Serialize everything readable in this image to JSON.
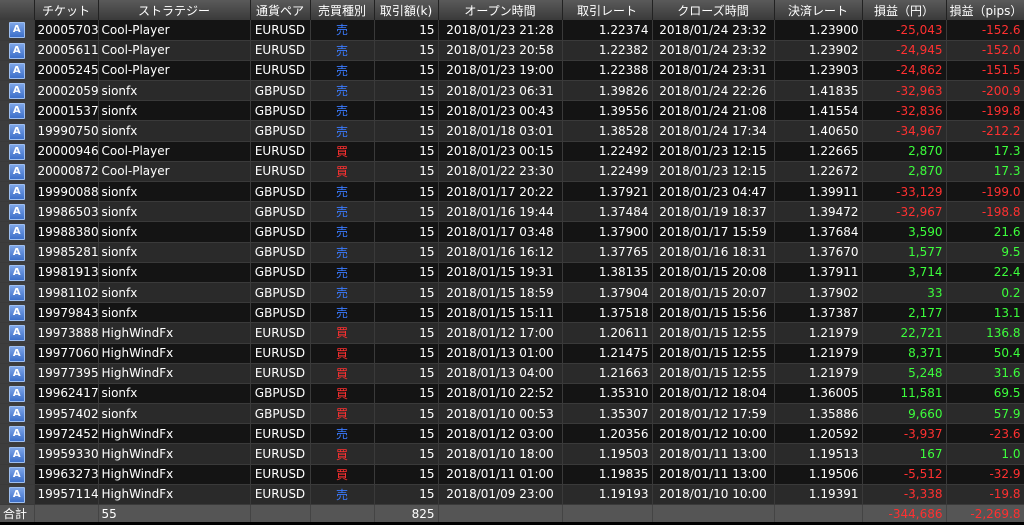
{
  "headers": {
    "icon": "",
    "ticket": "チケット",
    "strategy": "ストラテジー",
    "pair": "通貨ペア",
    "side": "売買種別",
    "amount": "取引額(k)",
    "open_time": "オープン時間",
    "open_rate": "取引レート",
    "close_time": "クローズ時間",
    "close_rate": "決済レート",
    "pl_yen": "損益（円）",
    "pl_pips": "損益（pips）"
  },
  "colors": {
    "sell": "#3a7bff",
    "buy": "#ff3030",
    "profit": "#3cff3c",
    "loss": "#ff3030"
  },
  "row_icon": "A",
  "rows": [
    {
      "ticket": "20005703",
      "strategy": "Cool-Player",
      "pair": "EURUSD",
      "side": "売",
      "amount": "15",
      "open_time": "2018/01/23 21:28",
      "open_rate": "1.22374",
      "close_time": "2018/01/24 23:32",
      "close_rate": "1.23900",
      "pl": "-25,043",
      "pips": "-152.6"
    },
    {
      "ticket": "20005611",
      "strategy": "Cool-Player",
      "pair": "EURUSD",
      "side": "売",
      "amount": "15",
      "open_time": "2018/01/23 20:58",
      "open_rate": "1.22382",
      "close_time": "2018/01/24 23:32",
      "close_rate": "1.23902",
      "pl": "-24,945",
      "pips": "-152.0"
    },
    {
      "ticket": "20005245",
      "strategy": "Cool-Player",
      "pair": "EURUSD",
      "side": "売",
      "amount": "15",
      "open_time": "2018/01/23 19:00",
      "open_rate": "1.22388",
      "close_time": "2018/01/24 23:31",
      "close_rate": "1.23903",
      "pl": "-24,862",
      "pips": "-151.5"
    },
    {
      "ticket": "20002059",
      "strategy": "sionfx",
      "pair": "GBPUSD",
      "side": "売",
      "amount": "15",
      "open_time": "2018/01/23 06:31",
      "open_rate": "1.39826",
      "close_time": "2018/01/24 22:26",
      "close_rate": "1.41835",
      "pl": "-32,963",
      "pips": "-200.9"
    },
    {
      "ticket": "20001537",
      "strategy": "sionfx",
      "pair": "GBPUSD",
      "side": "売",
      "amount": "15",
      "open_time": "2018/01/23 00:43",
      "open_rate": "1.39556",
      "close_time": "2018/01/24 21:08",
      "close_rate": "1.41554",
      "pl": "-32,836",
      "pips": "-199.8"
    },
    {
      "ticket": "19990750",
      "strategy": "sionfx",
      "pair": "GBPUSD",
      "side": "売",
      "amount": "15",
      "open_time": "2018/01/18 03:01",
      "open_rate": "1.38528",
      "close_time": "2018/01/24 17:34",
      "close_rate": "1.40650",
      "pl": "-34,967",
      "pips": "-212.2"
    },
    {
      "ticket": "20000946",
      "strategy": "Cool-Player",
      "pair": "EURUSD",
      "side": "買",
      "amount": "15",
      "open_time": "2018/01/23 00:15",
      "open_rate": "1.22492",
      "close_time": "2018/01/23 12:15",
      "close_rate": "1.22665",
      "pl": "2,870",
      "pips": "17.3"
    },
    {
      "ticket": "20000872",
      "strategy": "Cool-Player",
      "pair": "EURUSD",
      "side": "買",
      "amount": "15",
      "open_time": "2018/01/22 23:30",
      "open_rate": "1.22499",
      "close_time": "2018/01/23 12:15",
      "close_rate": "1.22672",
      "pl": "2,870",
      "pips": "17.3"
    },
    {
      "ticket": "19990088",
      "strategy": "sionfx",
      "pair": "GBPUSD",
      "side": "売",
      "amount": "15",
      "open_time": "2018/01/17 20:22",
      "open_rate": "1.37921",
      "close_time": "2018/01/23 04:47",
      "close_rate": "1.39911",
      "pl": "-33,129",
      "pips": "-199.0"
    },
    {
      "ticket": "19986503",
      "strategy": "sionfx",
      "pair": "GBPUSD",
      "side": "売",
      "amount": "15",
      "open_time": "2018/01/16 19:44",
      "open_rate": "1.37484",
      "close_time": "2018/01/19 18:37",
      "close_rate": "1.39472",
      "pl": "-32,967",
      "pips": "-198.8"
    },
    {
      "ticket": "19988380",
      "strategy": "sionfx",
      "pair": "GBPUSD",
      "side": "売",
      "amount": "15",
      "open_time": "2018/01/17 03:48",
      "open_rate": "1.37900",
      "close_time": "2018/01/17 15:59",
      "close_rate": "1.37684",
      "pl": "3,590",
      "pips": "21.6"
    },
    {
      "ticket": "19985281",
      "strategy": "sionfx",
      "pair": "GBPUSD",
      "side": "売",
      "amount": "15",
      "open_time": "2018/01/16 16:12",
      "open_rate": "1.37765",
      "close_time": "2018/01/16 18:31",
      "close_rate": "1.37670",
      "pl": "1,577",
      "pips": "9.5"
    },
    {
      "ticket": "19981913",
      "strategy": "sionfx",
      "pair": "GBPUSD",
      "side": "売",
      "amount": "15",
      "open_time": "2018/01/15 19:31",
      "open_rate": "1.38135",
      "close_time": "2018/01/15 20:08",
      "close_rate": "1.37911",
      "pl": "3,714",
      "pips": "22.4"
    },
    {
      "ticket": "19981102",
      "strategy": "sionfx",
      "pair": "GBPUSD",
      "side": "売",
      "amount": "15",
      "open_time": "2018/01/15 18:59",
      "open_rate": "1.37904",
      "close_time": "2018/01/15 20:07",
      "close_rate": "1.37902",
      "pl": "33",
      "pips": "0.2"
    },
    {
      "ticket": "19979843",
      "strategy": "sionfx",
      "pair": "GBPUSD",
      "side": "売",
      "amount": "15",
      "open_time": "2018/01/15 15:11",
      "open_rate": "1.37518",
      "close_time": "2018/01/15 15:56",
      "close_rate": "1.37387",
      "pl": "2,177",
      "pips": "13.1"
    },
    {
      "ticket": "19973888",
      "strategy": "HighWindFx",
      "pair": "EURUSD",
      "side": "買",
      "amount": "15",
      "open_time": "2018/01/12 17:00",
      "open_rate": "1.20611",
      "close_time": "2018/01/15 12:55",
      "close_rate": "1.21979",
      "pl": "22,721",
      "pips": "136.8"
    },
    {
      "ticket": "19977060",
      "strategy": "HighWindFx",
      "pair": "EURUSD",
      "side": "買",
      "amount": "15",
      "open_time": "2018/01/13 01:00",
      "open_rate": "1.21475",
      "close_time": "2018/01/15 12:55",
      "close_rate": "1.21979",
      "pl": "8,371",
      "pips": "50.4"
    },
    {
      "ticket": "19977395",
      "strategy": "HighWindFx",
      "pair": "EURUSD",
      "side": "買",
      "amount": "15",
      "open_time": "2018/01/13 04:00",
      "open_rate": "1.21663",
      "close_time": "2018/01/15 12:55",
      "close_rate": "1.21979",
      "pl": "5,248",
      "pips": "31.6"
    },
    {
      "ticket": "19962417",
      "strategy": "sionfx",
      "pair": "GBPUSD",
      "side": "買",
      "amount": "15",
      "open_time": "2018/01/10 22:52",
      "open_rate": "1.35310",
      "close_time": "2018/01/12 18:04",
      "close_rate": "1.36005",
      "pl": "11,581",
      "pips": "69.5"
    },
    {
      "ticket": "19957402",
      "strategy": "sionfx",
      "pair": "GBPUSD",
      "side": "買",
      "amount": "15",
      "open_time": "2018/01/10 00:53",
      "open_rate": "1.35307",
      "close_time": "2018/01/12 17:59",
      "close_rate": "1.35886",
      "pl": "9,660",
      "pips": "57.9"
    },
    {
      "ticket": "19972452",
      "strategy": "HighWindFx",
      "pair": "EURUSD",
      "side": "売",
      "amount": "15",
      "open_time": "2018/01/12 03:00",
      "open_rate": "1.20356",
      "close_time": "2018/01/12 10:00",
      "close_rate": "1.20592",
      "pl": "-3,937",
      "pips": "-23.6"
    },
    {
      "ticket": "19959330",
      "strategy": "HighWindFx",
      "pair": "EURUSD",
      "side": "買",
      "amount": "15",
      "open_time": "2018/01/10 18:00",
      "open_rate": "1.19503",
      "close_time": "2018/01/11 13:00",
      "close_rate": "1.19513",
      "pl": "167",
      "pips": "1.0"
    },
    {
      "ticket": "19963273",
      "strategy": "HighWindFx",
      "pair": "EURUSD",
      "side": "買",
      "amount": "15",
      "open_time": "2018/01/11 01:00",
      "open_rate": "1.19835",
      "close_time": "2018/01/11 13:00",
      "close_rate": "1.19506",
      "pl": "-5,512",
      "pips": "-32.9"
    },
    {
      "ticket": "19957114",
      "strategy": "HighWindFx",
      "pair": "EURUSD",
      "side": "売",
      "amount": "15",
      "open_time": "2018/01/09 23:00",
      "open_rate": "1.19193",
      "close_time": "2018/01/10 10:00",
      "close_rate": "1.19391",
      "pl": "-3,338",
      "pips": "-19.8"
    }
  ],
  "footer": {
    "label": "合計",
    "count": "55",
    "amount": "825",
    "pl": "-344,686",
    "pips": "-2,269.8"
  }
}
